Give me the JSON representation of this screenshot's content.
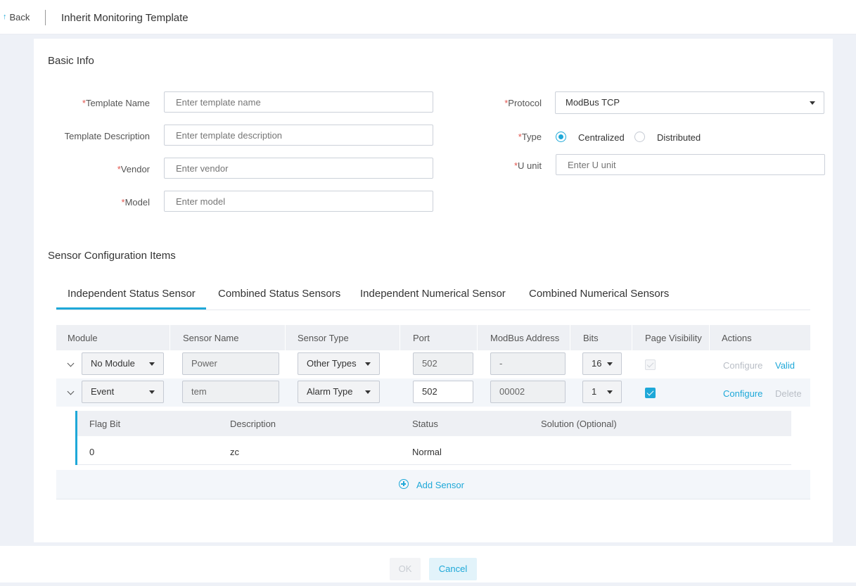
{
  "header": {
    "back_icon": "back-arrow-icon",
    "back_label": "Back",
    "title": "Inherit Monitoring Template"
  },
  "basic_info": {
    "title": "Basic Info",
    "template_name": {
      "required_mark": "*",
      "label": "Template Name",
      "placeholder": "Enter template name"
    },
    "template_description": {
      "label": "Template Description",
      "placeholder": "Enter template description"
    },
    "vendor": {
      "required_mark": "*",
      "label": "Vendor",
      "placeholder": "Enter vendor"
    },
    "model": {
      "required_mark": "*",
      "label": "Model",
      "placeholder": "Enter model"
    },
    "protocol": {
      "required_mark": "*",
      "label": "Protocol",
      "value": "ModBus TCP"
    },
    "type": {
      "required_mark": "*",
      "label": "Type",
      "options": [
        "Centralized",
        "Distributed"
      ],
      "selected": "Centralized"
    },
    "u_unit": {
      "required_mark": "*",
      "label": "U unit",
      "placeholder": "Enter U unit"
    }
  },
  "sensor_config": {
    "title": "Sensor Configuration Items",
    "tabs": [
      {
        "label": "Independent Status Sensor",
        "active": true
      },
      {
        "label": "Combined Status Sensors",
        "active": false
      },
      {
        "label": "Independent Numerical Sensor",
        "active": false
      },
      {
        "label": "Combined Numerical Sensors",
        "active": false
      }
    ],
    "columns": [
      "Module",
      "Sensor Name",
      "Sensor Type",
      "Port",
      "ModBus Address",
      "Bits",
      "Page Visibility",
      "Actions"
    ],
    "rows": [
      {
        "module": "No Module",
        "sensor_name": "Power",
        "sensor_type": "Other Types",
        "port": "502",
        "modbus_address": "-",
        "bits": "16",
        "page_visibility": true,
        "visibility_disabled": true,
        "actions": [
          "Configure",
          "Valid"
        ]
      },
      {
        "module": "Event",
        "sensor_name": "tem",
        "sensor_type": "Alarm Type",
        "port": "502",
        "modbus_address": "00002",
        "bits": "1",
        "page_visibility": true,
        "visibility_disabled": false,
        "actions": [
          "Configure",
          "Delete"
        ]
      }
    ],
    "sub_table": {
      "columns": [
        "Flag Bit",
        "Description",
        "Status",
        "Solution (Optional)"
      ],
      "rows": [
        {
          "flag_bit": "0",
          "description": "zc",
          "status": "Normal",
          "solution": ""
        }
      ]
    },
    "add_sensor_label": "Add Sensor",
    "add_sensor_icon": "plus-circle-icon"
  },
  "footer": {
    "ok_label": "OK",
    "cancel_label": "Cancel"
  },
  "colors": {
    "accent": "#1ea8d8",
    "required": "#e2564f",
    "page_bg": "#eef1f7"
  }
}
